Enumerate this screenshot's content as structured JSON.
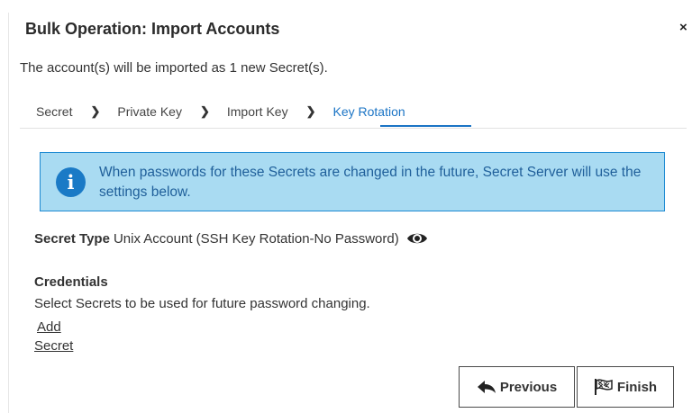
{
  "dialog": {
    "title": "Bulk Operation: Import Accounts",
    "close_glyph": "×",
    "subtitle": "The account(s) will be imported as 1 new Secret(s)."
  },
  "steps": [
    {
      "label": "Secret",
      "active": false
    },
    {
      "label": "Private Key",
      "active": false
    },
    {
      "label": "Import Key",
      "active": false
    },
    {
      "label": "Key Rotation",
      "active": true
    }
  ],
  "info_box": {
    "icon": "info-icon",
    "text": "When passwords for these Secrets are changed in the future, Secret Server will use the settings below."
  },
  "secret_type": {
    "label": "Secret Type",
    "value": "Unix Account (SSH Key Rotation-No Password)",
    "icon": "eye-icon"
  },
  "credentials": {
    "title": "Credentials",
    "description": "Select Secrets to be used for future password changing.",
    "add_link": "Add",
    "secret_link": "Secret"
  },
  "buttons": {
    "previous": "Previous",
    "finish": "Finish"
  },
  "colors": {
    "accent": "#1b74c5",
    "info_bg": "#a9dbf2",
    "info_border": "#1e8ad2"
  }
}
